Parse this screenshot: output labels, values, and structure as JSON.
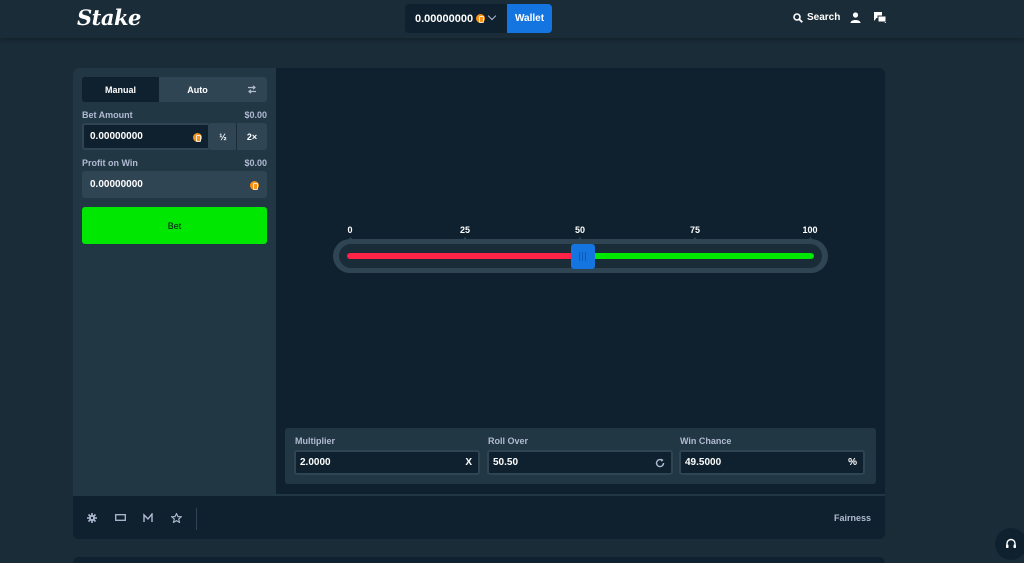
{
  "header": {
    "logo": "Stake",
    "balance": "0.00000000",
    "wallet_label": "Wallet",
    "search_label": "Search"
  },
  "sidebar": {
    "tabs": [
      {
        "label": "Manual",
        "active": true
      },
      {
        "label": "Auto",
        "active": false
      }
    ],
    "bet_amount": {
      "label": "Bet Amount",
      "usd": "$0.00",
      "value": "0.00000000",
      "half_label": "½",
      "double_label": "2×"
    },
    "profit": {
      "label": "Profit on Win",
      "usd": "$0.00",
      "value": "0.00000000"
    },
    "bet_button": "Bet"
  },
  "slider": {
    "ticks": [
      "0",
      "25",
      "50",
      "75",
      "100"
    ],
    "value": 50.5,
    "lose_color": "#fe2247",
    "win_color": "#00e701"
  },
  "stats": {
    "multiplier": {
      "label": "Multiplier",
      "value": "2.0000",
      "suffix": "X"
    },
    "roll_over": {
      "label": "Roll Over",
      "value": "50.50"
    },
    "win_chance": {
      "label": "Win Chance",
      "value": "49.5000",
      "suffix": "%"
    }
  },
  "footer": {
    "icons": [
      "settings-icon",
      "theatre-icon",
      "stats-icon",
      "favourite-icon"
    ],
    "fairness_label": "Fairness"
  },
  "colors": {
    "accent": "#1475e1",
    "bet": "#00e701",
    "bg": "#1a2c38",
    "panel": "#0f212e"
  }
}
